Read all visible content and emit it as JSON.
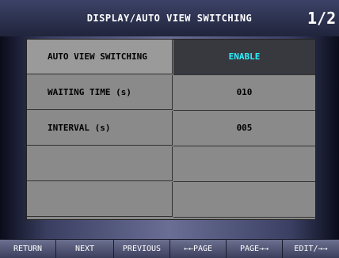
{
  "header": {
    "title": "DISPLAY/AUTO VIEW SWITCHING",
    "page": "1/2"
  },
  "settings": [
    {
      "label": "AUTO VIEW SWITCHING",
      "value": "ENABLE"
    },
    {
      "label": "WAITING TIME (s)",
      "value": "010"
    },
    {
      "label": "INTERVAL (s)",
      "value": "005"
    },
    {
      "label": "",
      "value": ""
    },
    {
      "label": "",
      "value": ""
    }
  ],
  "buttons": {
    "return": "RETURN",
    "next": "NEXT",
    "previous": "PREVIOUS",
    "page_prev": "←←PAGE",
    "page_next": "PAGE→→",
    "edit": "EDIT/→→"
  },
  "colors": {
    "selected_value": "#2ef0ff"
  }
}
